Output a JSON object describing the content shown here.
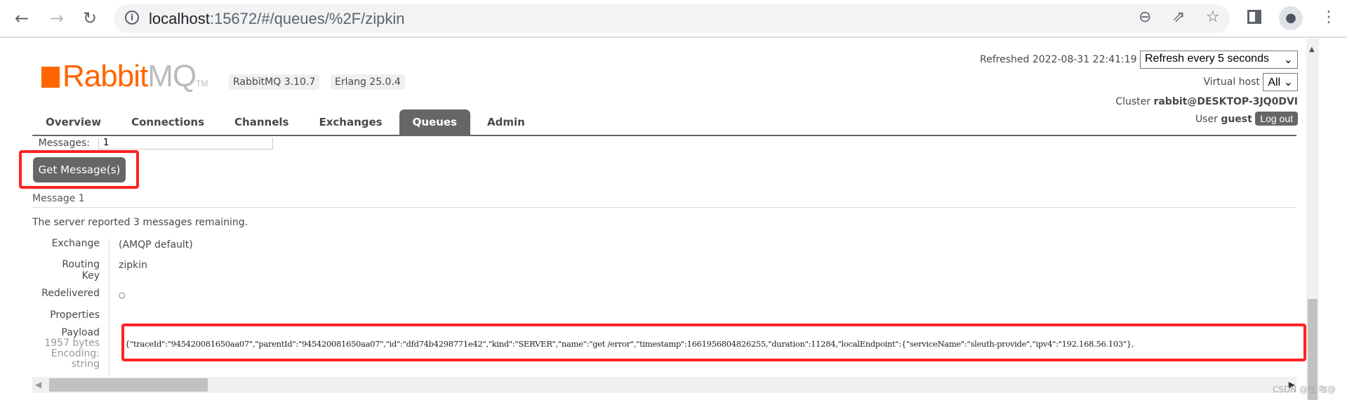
{
  "browser": {
    "url_host": "localhost",
    "url_rest": ":15672/#/queues/%2F/zipkin"
  },
  "header": {
    "logo": {
      "rabbit": "Rabbit",
      "mq": "MQ",
      "tm": "TM"
    },
    "rabbitmq_version": "RabbitMQ 3.10.7",
    "erlang_version": "Erlang 25.0.4",
    "refreshed": "Refreshed 2022-08-31 22:41:19",
    "refresh_select": "Refresh every 5 seconds",
    "vhost_label": "Virtual host",
    "vhost_select": "All",
    "cluster_label": "Cluster",
    "cluster_name": "rabbit@DESKTOP-3JQ0DVI",
    "user_label": "User",
    "user_name": "guest",
    "logout": "Log out"
  },
  "tabs": [
    "Overview",
    "Connections",
    "Channels",
    "Exchanges",
    "Queues",
    "Admin"
  ],
  "active_tab": "Queues",
  "get": {
    "messages_label": "Messages:",
    "messages_value": "1",
    "button": "Get Message(s)"
  },
  "message": {
    "title": "Message 1",
    "remaining": "The server reported 3 messages remaining.",
    "exchange_label": "Exchange",
    "exchange": "(AMQP default)",
    "routing_label1": "Routing",
    "routing_label2": "Key",
    "routing_key": "zipkin",
    "redelivered_label": "Redelivered",
    "redelivered": "○",
    "properties_label": "Properties",
    "payload_label": "Payload",
    "payload_size": "1957 bytes",
    "payload_encoding_label": "Encoding:",
    "payload_encoding": "string",
    "payload": "{\"traceId\":\"945420081650aa07\",\"parentId\":\"945420081650aa07\",\"id\":\"dfd74b4298771e42\",\"kind\":\"SERVER\",\"name\":\"get /error\",\"timestamp\":1661956804826255,\"duration\":11284,\"localEndpoint\":{\"serviceName\":\"sleuth-provide\",\"ipv4\":\"192.168.56.103\"},"
  },
  "watermark": "CSDN @怪 咖@",
  "colors": {
    "brand": "#ff6600",
    "highlight": "#ff2222",
    "tab_active": "#666666"
  }
}
